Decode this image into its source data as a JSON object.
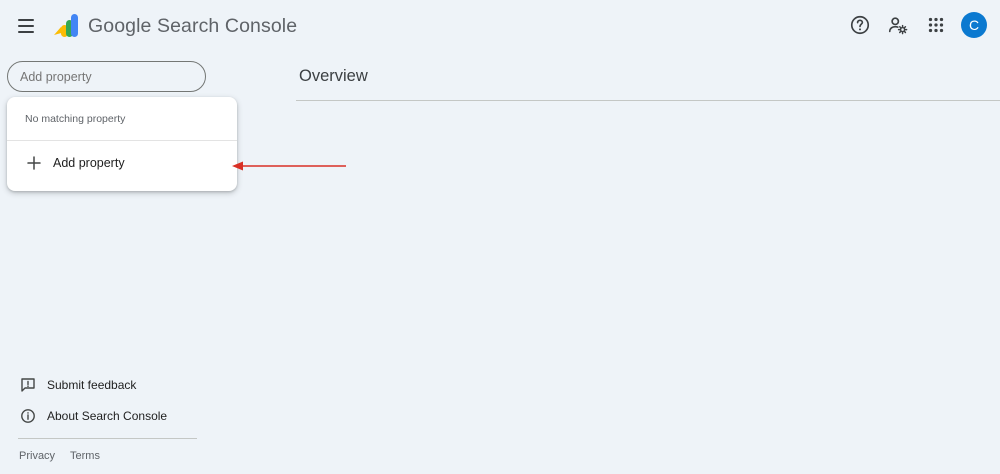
{
  "header": {
    "app_name": "Google Search Console",
    "avatar_letter": "C",
    "icons": [
      "menu-icon",
      "search-console-logo",
      "help-icon",
      "settings-icon",
      "apps-grid-icon"
    ]
  },
  "property_selector": {
    "placeholder": "Add property"
  },
  "dropdown": {
    "no_match_text": "No matching property",
    "add_label": "Add property"
  },
  "main": {
    "title": "Overview"
  },
  "sidebar_footer": {
    "feedback_label": "Submit feedback",
    "about_label": "About Search Console",
    "privacy_label": "Privacy",
    "terms_label": "Terms"
  },
  "colors": {
    "background": "#eef3f8",
    "annotation_arrow": "#d93025",
    "avatar": "#0b79d0"
  }
}
